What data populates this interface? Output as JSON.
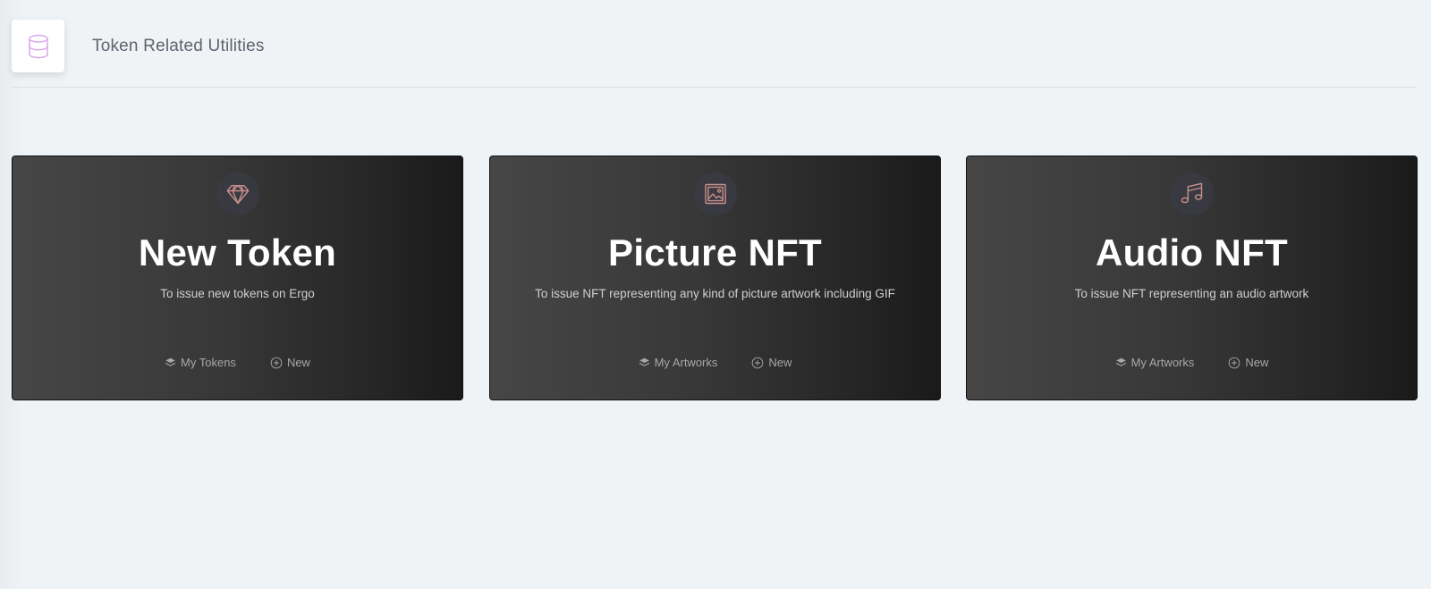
{
  "header": {
    "title": "Token Related Utilities",
    "icon": "database-icon"
  },
  "cards": [
    {
      "title": "New Token",
      "description": "To issue new tokens on Ergo",
      "icon": "diamond-icon",
      "actions": [
        {
          "label": "My Tokens",
          "icon": "layers-icon"
        },
        {
          "label": "New",
          "icon": "plus-circle-icon"
        }
      ]
    },
    {
      "title": "Picture NFT",
      "description": "To issue NFT representing any kind of picture artwork including GIF",
      "icon": "image-icon",
      "actions": [
        {
          "label": "My Artworks",
          "icon": "layers-icon"
        },
        {
          "label": "New",
          "icon": "plus-circle-icon"
        }
      ]
    },
    {
      "title": "Audio NFT",
      "description": "To issue NFT representing an audio artwork",
      "icon": "music-icon",
      "actions": [
        {
          "label": "My Artworks",
          "icon": "layers-icon"
        },
        {
          "label": "New",
          "icon": "plus-circle-icon"
        }
      ]
    }
  ],
  "colors": {
    "background": "#f0f3f6",
    "icon_accent": "#c88e8e",
    "header_icon": "#d4a5e6"
  }
}
